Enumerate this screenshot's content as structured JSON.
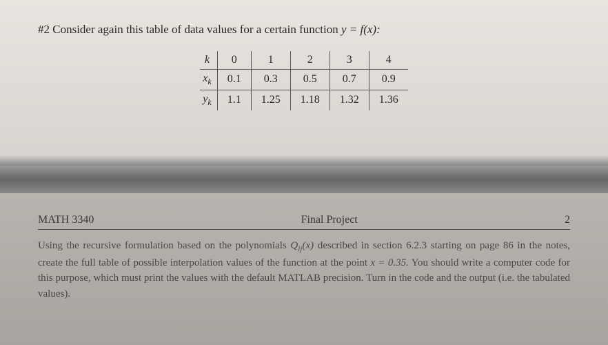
{
  "problem": {
    "number": "#2",
    "text_before": "Consider again this table of data values for a certain function",
    "equation": "y = f(x):"
  },
  "table": {
    "rows": [
      {
        "label": "k",
        "values": [
          "0",
          "1",
          "2",
          "3",
          "4"
        ]
      },
      {
        "label": "xk",
        "values": [
          "0.1",
          "0.3",
          "0.5",
          "0.7",
          "0.9"
        ]
      },
      {
        "label": "yk",
        "values": [
          "1.1",
          "1.25",
          "1.18",
          "1.32",
          "1.36"
        ]
      }
    ]
  },
  "page_header": {
    "course": "MATH 3340",
    "title": "Final Project",
    "page": "2"
  },
  "body": {
    "part1": "Using the recursive formulation based on the polynomials ",
    "poly": "Qij(x)",
    "part2": " described in section 6.2.3 starting on page 86 in the notes, create the full table of possible interpolation values of the function at the point ",
    "point": "x = 0.35.",
    "part3": " You should write a computer code for this purpose, which must print the values with the default MATLAB precision. Turn in the code and the output (i.e. the tabulated values)."
  }
}
